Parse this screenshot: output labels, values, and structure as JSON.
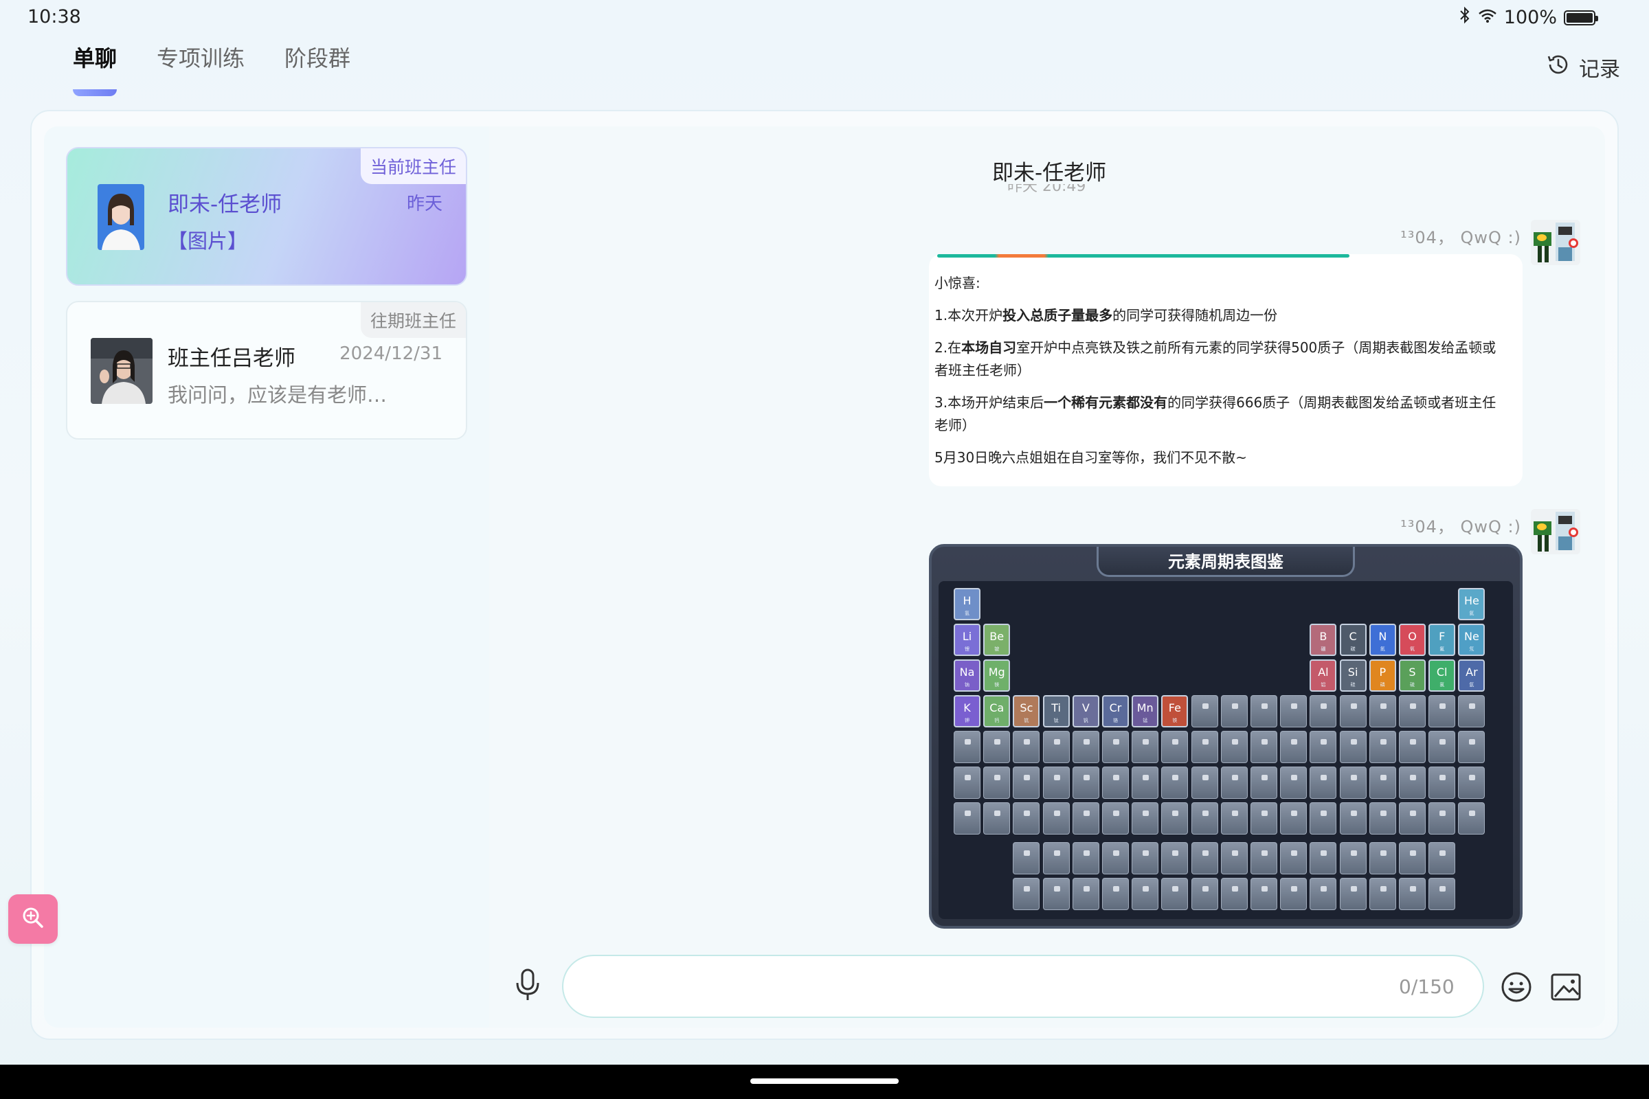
{
  "status_bar": {
    "time": "10:38",
    "battery": "100%",
    "icons": [
      "bluetooth-icon",
      "wifi-icon",
      "battery-icon"
    ]
  },
  "tabs": [
    {
      "label": "单聊",
      "active": true
    },
    {
      "label": "专项训练",
      "active": false
    },
    {
      "label": "阶段群",
      "active": false
    }
  ],
  "record_label": "记录",
  "conversations": [
    {
      "tag": "当前班主任",
      "name": "即未-任老师",
      "time": "昨天",
      "preview": "【图片】"
    },
    {
      "tag": "往期班主任",
      "name": "班主任吕老师",
      "time": "2024/12/31",
      "preview": "我问问，应该是有老师统…"
    }
  ],
  "chat": {
    "title": "即未-任老师",
    "subtime": "昨天 20:49",
    "messages": [
      {
        "sender": "¹³04， QwQ :)",
        "type": "text",
        "paragraphs": [
          {
            "parts": [
              {
                "t": "小惊喜:"
              }
            ]
          },
          {
            "parts": [
              {
                "t": "1.本次开炉"
              },
              {
                "t": "投入总质子量最多",
                "b": true
              },
              {
                "t": "的同学可获得随机周边一份"
              }
            ]
          },
          {
            "parts": [
              {
                "t": "2.在"
              },
              {
                "t": "本场自习",
                "b": true
              },
              {
                "t": "室开炉中点亮铁及铁之前所有元素的同学获得500质子（周期表截图发给孟顿或者班主任老师）"
              }
            ]
          },
          {
            "parts": [
              {
                "t": "3.本场开炉结束后"
              },
              {
                "t": "一个稀有元素都没有",
                "b": true
              },
              {
                "t": "的同学获得666质子（周期表截图发给孟顿或者班主任老师）"
              }
            ]
          },
          {
            "parts": [
              {
                "t": "5月30日晚六点姐姐在自习室等你，我们不见不散~"
              }
            ]
          }
        ]
      },
      {
        "sender": "¹³04， QwQ :)",
        "type": "image",
        "image_title": "元素周期表图鉴",
        "unlocked_elements": [
          {
            "sym": "H",
            "sub": "氢",
            "color": "#6f8fc8",
            "row": 0,
            "col": 0
          },
          {
            "sym": "He",
            "sub": "氦",
            "color": "#5aa8c9",
            "row": 0,
            "col": 17
          },
          {
            "sym": "Li",
            "sub": "锂",
            "color": "#7a6fd6",
            "row": 1,
            "col": 0
          },
          {
            "sym": "Be",
            "sub": "铍",
            "color": "#7bb06a",
            "row": 1,
            "col": 1
          },
          {
            "sym": "B",
            "sub": "硼",
            "color": "#b46a7a",
            "row": 1,
            "col": 12
          },
          {
            "sym": "C",
            "sub": "碳",
            "color": "#4e5a6a",
            "row": 1,
            "col": 13
          },
          {
            "sym": "N",
            "sub": "氮",
            "color": "#3e6fd6",
            "row": 1,
            "col": 14
          },
          {
            "sym": "O",
            "sub": "氧",
            "color": "#d64b5a",
            "row": 1,
            "col": 15
          },
          {
            "sym": "F",
            "sub": "氟",
            "color": "#4fa0c0",
            "row": 1,
            "col": 16
          },
          {
            "sym": "Ne",
            "sub": "氖",
            "color": "#4f9fc6",
            "row": 1,
            "col": 17
          },
          {
            "sym": "Na",
            "sub": "钠",
            "color": "#7a5fc8",
            "row": 2,
            "col": 0
          },
          {
            "sym": "Mg",
            "sub": "镁",
            "color": "#6fb06a",
            "row": 2,
            "col": 1
          },
          {
            "sym": "Al",
            "sub": "铝",
            "color": "#c45a6a",
            "row": 2,
            "col": 12
          },
          {
            "sym": "Si",
            "sub": "硅",
            "color": "#5a6676",
            "row": 2,
            "col": 13
          },
          {
            "sym": "P",
            "sub": "磷",
            "color": "#e0861f",
            "row": 2,
            "col": 14
          },
          {
            "sym": "S",
            "sub": "硫",
            "color": "#5aa05a",
            "row": 2,
            "col": 15
          },
          {
            "sym": "Cl",
            "sub": "氯",
            "color": "#3fae6a",
            "row": 2,
            "col": 16
          },
          {
            "sym": "Ar",
            "sub": "氩",
            "color": "#4e6aa8",
            "row": 2,
            "col": 17
          },
          {
            "sym": "K",
            "sub": "钾",
            "color": "#7a5fd0",
            "row": 3,
            "col": 0
          },
          {
            "sym": "Ca",
            "sub": "钙",
            "color": "#6fae6a",
            "row": 3,
            "col": 1
          },
          {
            "sym": "Sc",
            "sub": "钪",
            "color": "#b07a5a",
            "row": 3,
            "col": 2
          },
          {
            "sym": "Ti",
            "sub": "钛",
            "color": "#5a6a80",
            "row": 3,
            "col": 3
          },
          {
            "sym": "V",
            "sub": "钒",
            "color": "#6a6e9a",
            "row": 3,
            "col": 4
          },
          {
            "sym": "Cr",
            "sub": "铬",
            "color": "#5a6a9a",
            "row": 3,
            "col": 5
          },
          {
            "sym": "Mn",
            "sub": "锰",
            "color": "#6a5a9a",
            "row": 3,
            "col": 6
          },
          {
            "sym": "Fe",
            "sub": "铁",
            "color": "#c0503a",
            "row": 3,
            "col": 7
          }
        ]
      }
    ]
  },
  "input": {
    "counter": "0/150",
    "placeholder": ""
  },
  "colors": {
    "accent": "#6e7df2",
    "current_card_text": "#5b4fd0",
    "zoom_fab": "#f47aa5"
  }
}
